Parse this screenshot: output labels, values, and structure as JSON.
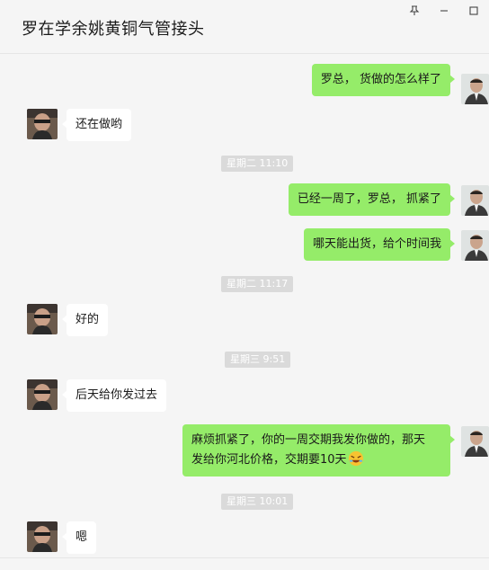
{
  "window": {
    "title": "罗在学余姚黄铜气管接头",
    "pin_icon": "pin-icon",
    "minimize_icon": "minimize-icon",
    "maximize_icon": "maximize-icon"
  },
  "colors": {
    "my_bubble": "#95ec69",
    "other_bubble": "#ffffff",
    "background": "#f5f5f5",
    "timestamp_bg": "#dadada"
  },
  "messages": [
    {
      "sender": "me",
      "text": "罗总， 货做的怎么样了"
    },
    {
      "sender": "other",
      "text": "还在做哟"
    },
    {
      "timestamp": "星期二 11:10"
    },
    {
      "sender": "me",
      "text": "已经一周了，罗总， 抓紧了"
    },
    {
      "sender": "me",
      "text": "哪天能出货，给个时间我"
    },
    {
      "timestamp": "星期二 11:17"
    },
    {
      "sender": "other",
      "text": "好的"
    },
    {
      "timestamp": "星期三 9:51"
    },
    {
      "sender": "other",
      "text": "后天给你发过去"
    },
    {
      "sender": "me",
      "text_line1": "麻烦抓紧了，你的一周交期我发你做的，那天",
      "text_line2": "发给你河北价格，交期要10天",
      "emoji": "rolling-laughing-emoji"
    },
    {
      "timestamp": "星期三 10:01"
    },
    {
      "sender": "other",
      "text": "嗯"
    }
  ]
}
